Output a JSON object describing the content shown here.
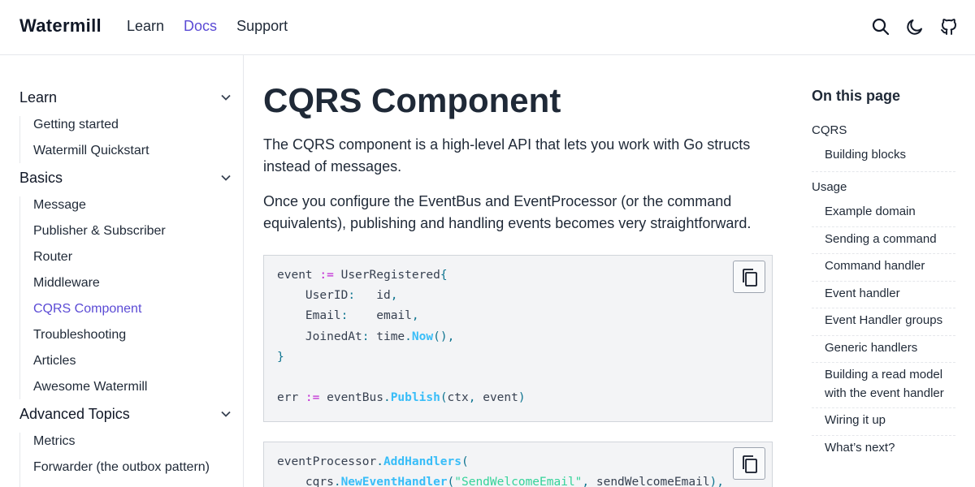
{
  "header": {
    "brand": "Watermill",
    "nav": [
      "Learn",
      "Docs",
      "Support"
    ],
    "active_nav": "Docs",
    "icons": [
      "search-icon",
      "moon-icon",
      "github-icon"
    ]
  },
  "sidebar": {
    "sections": [
      {
        "label": "Learn",
        "items": [
          "Getting started",
          "Watermill Quickstart"
        ]
      },
      {
        "label": "Basics",
        "items": [
          "Message",
          "Publisher & Subscriber",
          "Router",
          "Middleware",
          "CQRS Component",
          "Troubleshooting",
          "Articles",
          "Awesome Watermill"
        ]
      },
      {
        "label": "Advanced Topics",
        "items": [
          "Metrics",
          "Forwarder (the outbox pattern)"
        ]
      }
    ],
    "active_item": "CQRS Component"
  },
  "content": {
    "title": "CQRS Component",
    "paragraphs": [
      "The CQRS component is a high-level API that lets you work with Go structs instead of messages.",
      "Once you configure the EventBus and EventProcessor (or the command equivalents), publishing and handling events becomes very straightforward."
    ],
    "code_blocks": [
      {
        "lines": [
          "event := UserRegistered{",
          "    UserID:   id,",
          "    Email:    email,",
          "    JoinedAt: time.Now(),",
          "}",
          "",
          "err := eventBus.Publish(ctx, event)"
        ]
      },
      {
        "lines": [
          "eventProcessor.AddHandlers(",
          "    cqrs.NewEventHandler(\"SendWelcomeEmail\", sendWelcomeEmail),"
        ]
      }
    ]
  },
  "toc": {
    "title": "On this page",
    "entries": [
      {
        "label": "CQRS",
        "level": 1
      },
      {
        "label": "Building blocks",
        "level": 2
      },
      {
        "label": "Usage",
        "level": 1
      },
      {
        "label": "Example domain",
        "level": 2
      },
      {
        "label": "Sending a command",
        "level": 2
      },
      {
        "label": "Command handler",
        "level": 2
      },
      {
        "label": "Event handler",
        "level": 2
      },
      {
        "label": "Event Handler groups",
        "level": 2
      },
      {
        "label": "Generic handlers",
        "level": 2
      },
      {
        "label": "Building a read model with the event handler",
        "level": 2
      },
      {
        "label": "Wiring it up",
        "level": 2
      },
      {
        "label": "What’s next?",
        "level": 2
      }
    ]
  },
  "colors": {
    "accent": "#5b4bd5",
    "code_bg": "#f3f4f6",
    "border": "#e5e7eb"
  }
}
